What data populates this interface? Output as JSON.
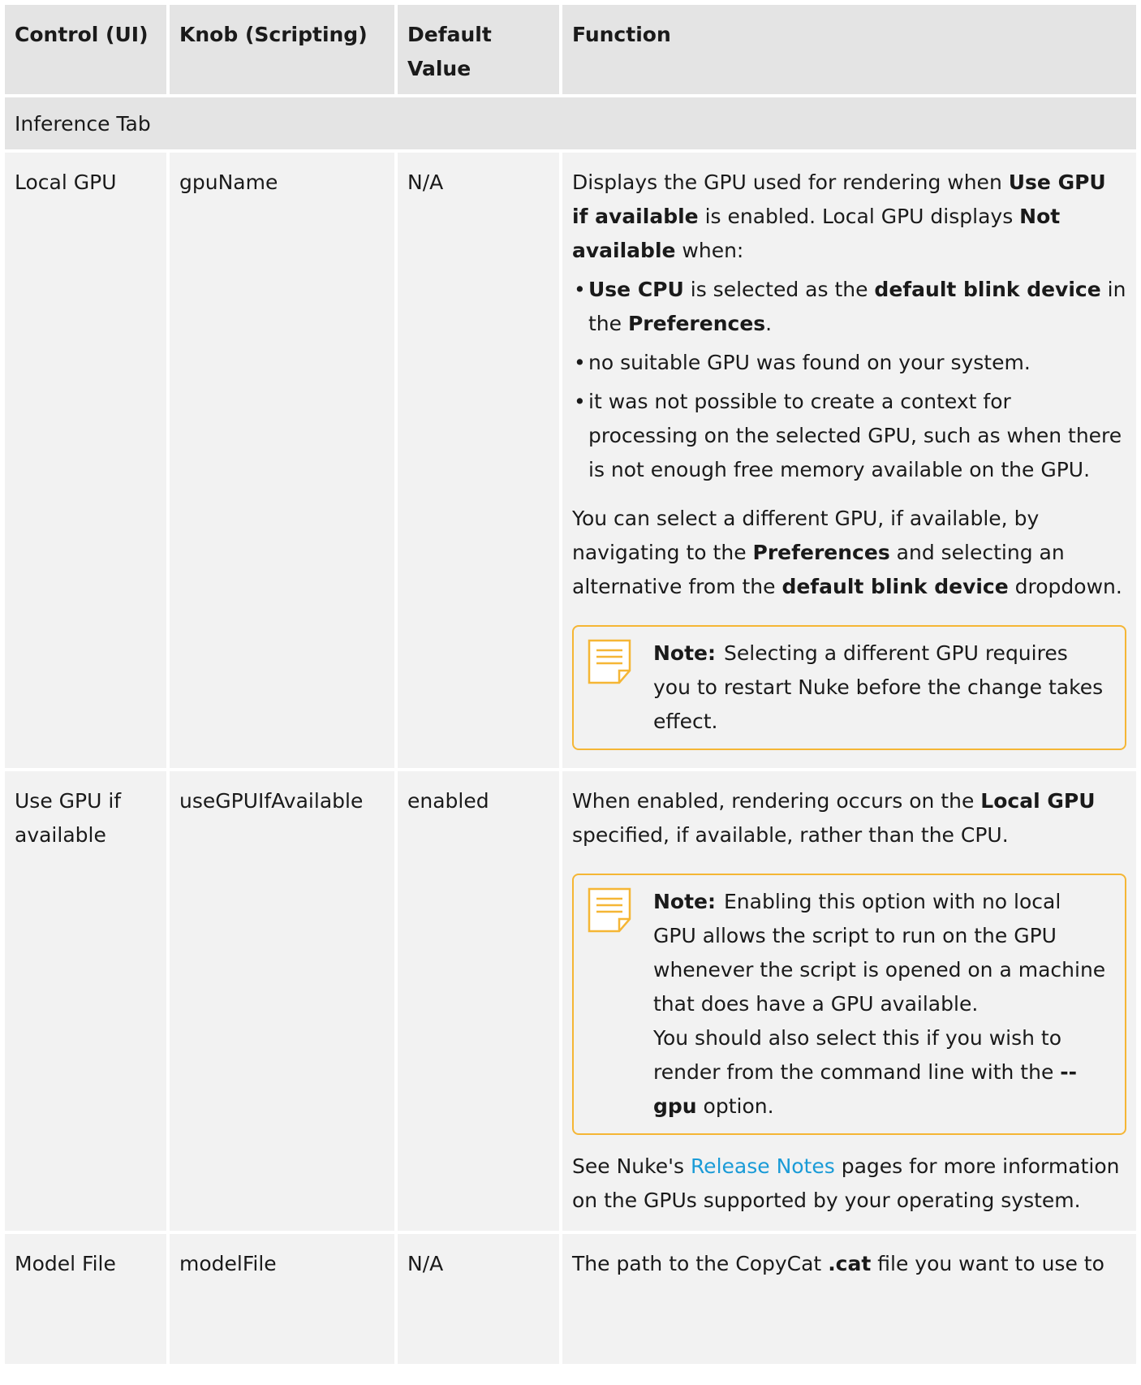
{
  "headers": [
    "Control (UI)",
    "Knob (Scripting)",
    "Default Value",
    "Function"
  ],
  "section": "Inference Tab",
  "rows": {
    "local_gpu": {
      "control": "Local GPU",
      "knob": "gpuName",
      "default": "N/A",
      "p1": [
        "Displays the GPU used for rendering when ",
        "Use GPU if available",
        " is enabled. Local GPU displays ",
        "Not available",
        " when:"
      ],
      "bullets": [
        [
          "Use CPU",
          " is selected as the ",
          "default blink device",
          " in the ",
          "Preferences",
          "."
        ],
        [
          "no suitable GPU was found on your system."
        ],
        [
          "it was not possible to create a context for processing on the selected GPU, such as when there is not enough free memory available on the GPU."
        ]
      ],
      "p2": [
        "You can select a different GPU, if available, by navigating to the ",
        "Preferences",
        " and selecting an alternative from the ",
        "default blink device",
        " dropdown."
      ],
      "note_label": "Note:",
      "note_text": "Selecting a different GPU requires you to restart Nuke before the change takes effect."
    },
    "use_gpu": {
      "control": "Use GPU if available",
      "knob": "useGPUIfAvailable",
      "default": "enabled",
      "p1": [
        "When enabled, rendering occurs on the ",
        "Local GPU",
        " specified, if available, rather than the CPU."
      ],
      "note_label": "Note:",
      "note_line1": "Enabling this option with no local GPU allows the script to run on the GPU whenever the script is opened on a machine that does have a GPU available.",
      "note_line2": [
        "You should also select this if you wish to render from the command line with the ",
        "--gpu",
        " option."
      ],
      "p2": [
        "See Nuke's ",
        "Release Notes",
        " pages for more information on the GPUs supported by your operating system."
      ]
    },
    "model_file": {
      "control": "Model File",
      "knob": "modelFile",
      "default": "N/A",
      "p1": [
        "The path to the CopyCat ",
        ".cat",
        " file you want to use to"
      ]
    }
  },
  "colors": {
    "header_bg": "#e4e4e4",
    "cell_bg": "#f2f2f2",
    "note_border": "#f5b635",
    "link": "#1a9bd7"
  },
  "icons": {
    "note": "note-document-icon"
  }
}
